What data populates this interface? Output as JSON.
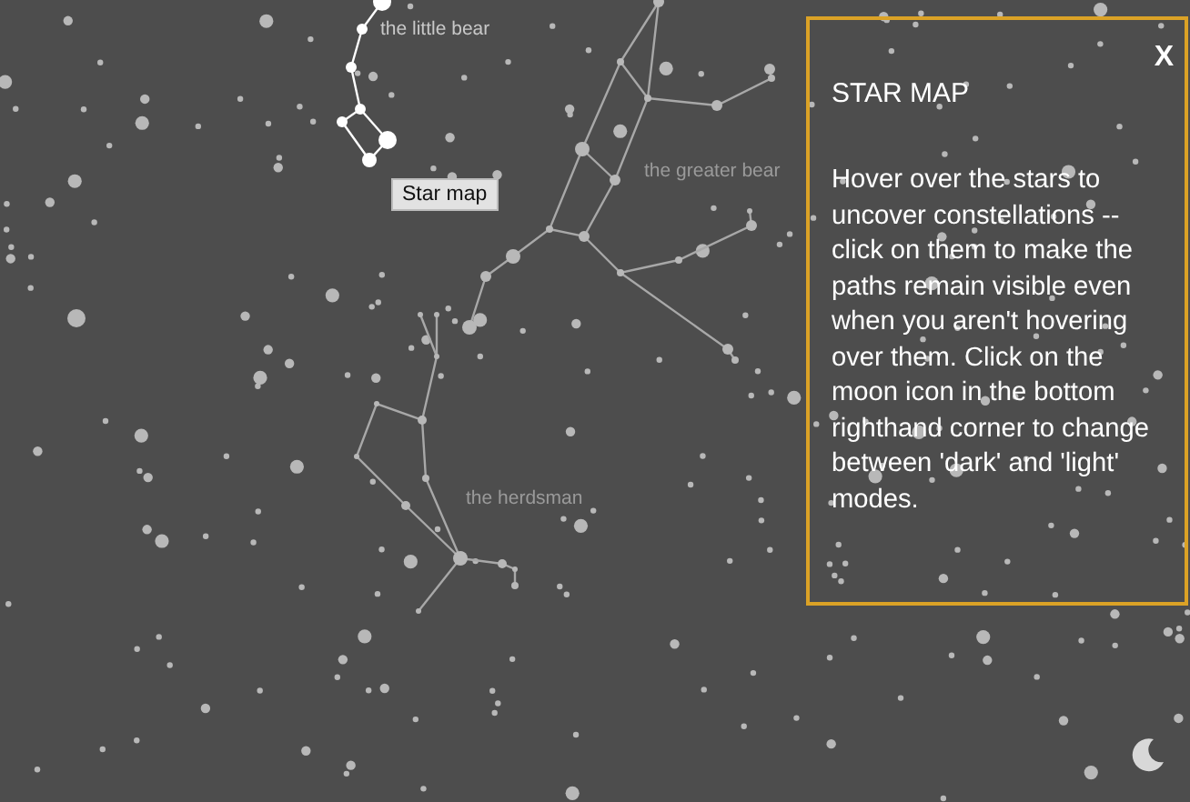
{
  "constellations": [
    {
      "name": "the little bear",
      "selected": true
    },
    {
      "name": "the greater bear",
      "selected": false
    },
    {
      "name": "the herdsman",
      "selected": false
    }
  ],
  "tooltip": "Star map",
  "panel": {
    "title": "STAR MAP",
    "close": "X",
    "body": "Hover over the stars to uncover constellations -- click on them to make the paths remain visible even when you aren't hovering over them. Click on the moon icon in the bottom righthand corner to change between 'dark' and 'light' modes."
  }
}
